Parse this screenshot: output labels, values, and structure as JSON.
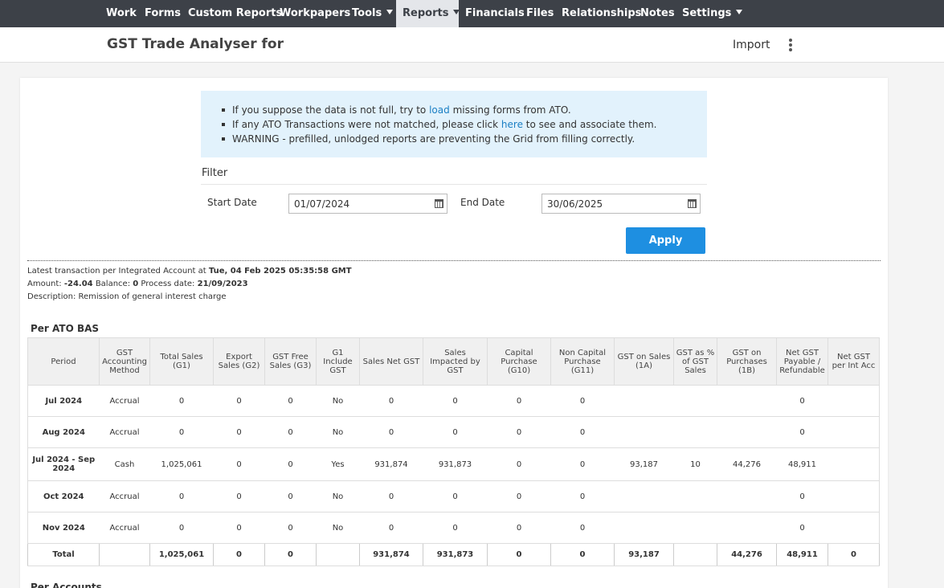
{
  "nav": {
    "items": [
      {
        "label": "Work"
      },
      {
        "label": "Forms"
      },
      {
        "label": "Custom Reports"
      },
      {
        "label": "Workpapers"
      },
      {
        "label": "Tools"
      },
      {
        "label": "Reports"
      },
      {
        "label": "Financials"
      },
      {
        "label": "Files"
      },
      {
        "label": "Relationships"
      },
      {
        "label": "Notes"
      },
      {
        "label": "Settings"
      }
    ]
  },
  "header": {
    "title": "GST Trade Analyser for",
    "import_label": "Import"
  },
  "info": {
    "line1_pre": "If you suppose the data is not full, try to ",
    "line1_link": "load",
    "line1_post": " missing forms from ATO.",
    "line2_pre": "If any ATO Transactions were not matched, please click ",
    "line2_link": "here",
    "line2_post": " to see and associate them.",
    "line3": "WARNING - prefilled, unlodged reports are preventing the Grid from filling correctly."
  },
  "filter": {
    "title": "Filter",
    "start_label": "Start Date",
    "start_value": "01/07/2024",
    "end_label": "End Date",
    "end_value": "30/06/2025",
    "apply_label": "Apply"
  },
  "meta": {
    "latest_pre": "Latest transaction per Integrated Account at ",
    "latest_value": "Tue, 04 Feb 2025 05:35:58 GMT",
    "amount_label": "Amount: ",
    "amount_value": "-24.04",
    "balance_label": " Balance: ",
    "balance_value": "0",
    "process_label": " Process date: ",
    "process_value": "21/09/2023",
    "description_label": "Description: ",
    "description_value": "Remission of general interest charge"
  },
  "ato_bas": {
    "title": "Per ATO BAS",
    "headers": [
      "Period",
      "GST Accounting Method",
      "Total Sales (G1)",
      "Export Sales (G2)",
      "GST Free Sales (G3)",
      "G1 Include GST",
      "Sales Net GST",
      "Sales Impacted by GST",
      "Capital Purchase (G10)",
      "Non Capital Purchase (G11)",
      "GST on Sales (1A)",
      "GST as % of GST Sales",
      "GST on Purchases (1B)",
      "Net GST Payable / Refundable",
      "Net GST per Int Acc"
    ],
    "rows": [
      [
        "Jul 2024",
        "Accrual",
        "0",
        "0",
        "0",
        "No",
        "0",
        "0",
        "0",
        "0",
        "",
        "",
        "",
        "0",
        ""
      ],
      [
        "Aug 2024",
        "Accrual",
        "0",
        "0",
        "0",
        "No",
        "0",
        "0",
        "0",
        "0",
        "",
        "",
        "",
        "0",
        ""
      ],
      [
        "Jul 2024 - Sep 2024",
        "Cash",
        "1,025,061",
        "0",
        "0",
        "Yes",
        "931,874",
        "931,873",
        "0",
        "0",
        "93,187",
        "10",
        "44,276",
        "48,911",
        ""
      ],
      [
        "Oct 2024",
        "Accrual",
        "0",
        "0",
        "0",
        "No",
        "0",
        "0",
        "0",
        "0",
        "",
        "",
        "",
        "0",
        ""
      ],
      [
        "Nov 2024",
        "Accrual",
        "0",
        "0",
        "0",
        "No",
        "0",
        "0",
        "0",
        "0",
        "",
        "",
        "",
        "0",
        ""
      ]
    ],
    "total": [
      "Total",
      "",
      "1,025,061",
      "0",
      "0",
      "",
      "931,874",
      "931,873",
      "0",
      "0",
      "93,187",
      "",
      "44,276",
      "48,911",
      "0"
    ]
  },
  "per_accounts": {
    "title": "Per Accounts"
  }
}
